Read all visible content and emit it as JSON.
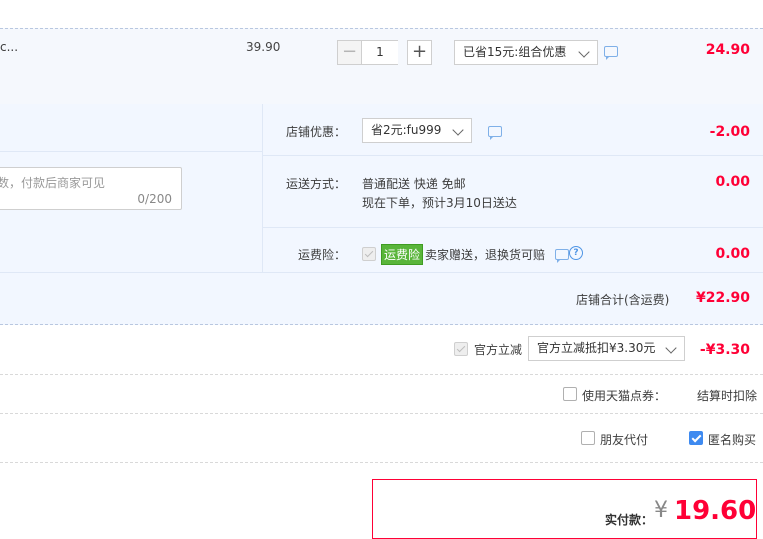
{
  "item": {
    "title_fragment": "c...",
    "unit_price": "39.90",
    "quantity": "1",
    "promo_select": "已省15元:组合优惠",
    "subtotal": "24.90"
  },
  "shop": {
    "coupon_label": "店铺优惠：",
    "coupon_select": "省2元:fu999",
    "coupon_amount": "-2.00",
    "message_placeholder": "数，付款后商家可见",
    "message_counter": "0/200",
    "shipping_label": "运送方式：",
    "shipping_method": "普通配送 快递 免邮",
    "shipping_eta": "现在下单，预计3月10日送达",
    "shipping_amount": "0.00",
    "insurance_label": "运费险：",
    "insurance_badge": "运费险",
    "insurance_text": "卖家赠送，退换货可赔",
    "insurance_amount": "0.00",
    "total_label": "店铺合计(含运费)",
    "total_amount": "¥22.90"
  },
  "discount": {
    "official_label": "官方立减",
    "official_select": "官方立减抵扣¥3.30元",
    "official_amount": "-¥3.30"
  },
  "points": {
    "label": "使用天猫点券：",
    "note": "结算时扣除"
  },
  "options": {
    "friend_pay": "朋友代付",
    "anonymous": "匿名购买"
  },
  "payment": {
    "label": "实付款：",
    "currency": "¥",
    "amount": "19.60"
  },
  "colors": {
    "price_red": "#ff0036",
    "accent_blue": "#3e8af0",
    "badge_green": "#59b53a",
    "panel_bg": "#f2f7ff"
  }
}
